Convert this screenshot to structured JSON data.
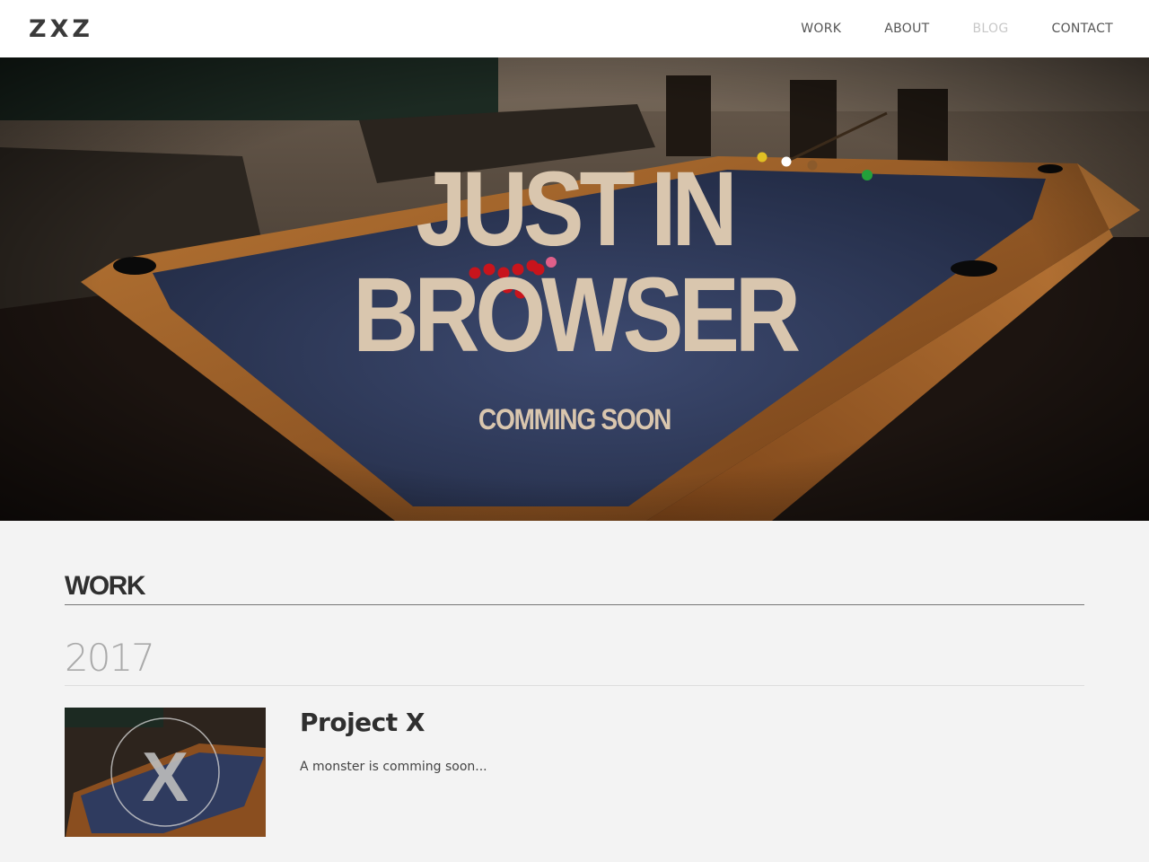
{
  "header": {
    "logo": "ZXZ",
    "nav": [
      {
        "label": "WORK"
      },
      {
        "label": "ABOUT"
      },
      {
        "label": "BLOG"
      },
      {
        "label": "CONTACT"
      }
    ]
  },
  "hero": {
    "line1": "JUST IN",
    "line2": "BROWSER",
    "subtitle": "COMMING SOON"
  },
  "work": {
    "title": "WORK",
    "year": "2017",
    "projects": [
      {
        "title": "Project X",
        "description": "A monster is comming soon...",
        "thumb_letter": "X"
      }
    ]
  },
  "colors": {
    "hero_text": "#d9c6ae",
    "felt": "#2e3a5c",
    "wood": "#a8642a",
    "nav_active": "#c8c8c8"
  }
}
